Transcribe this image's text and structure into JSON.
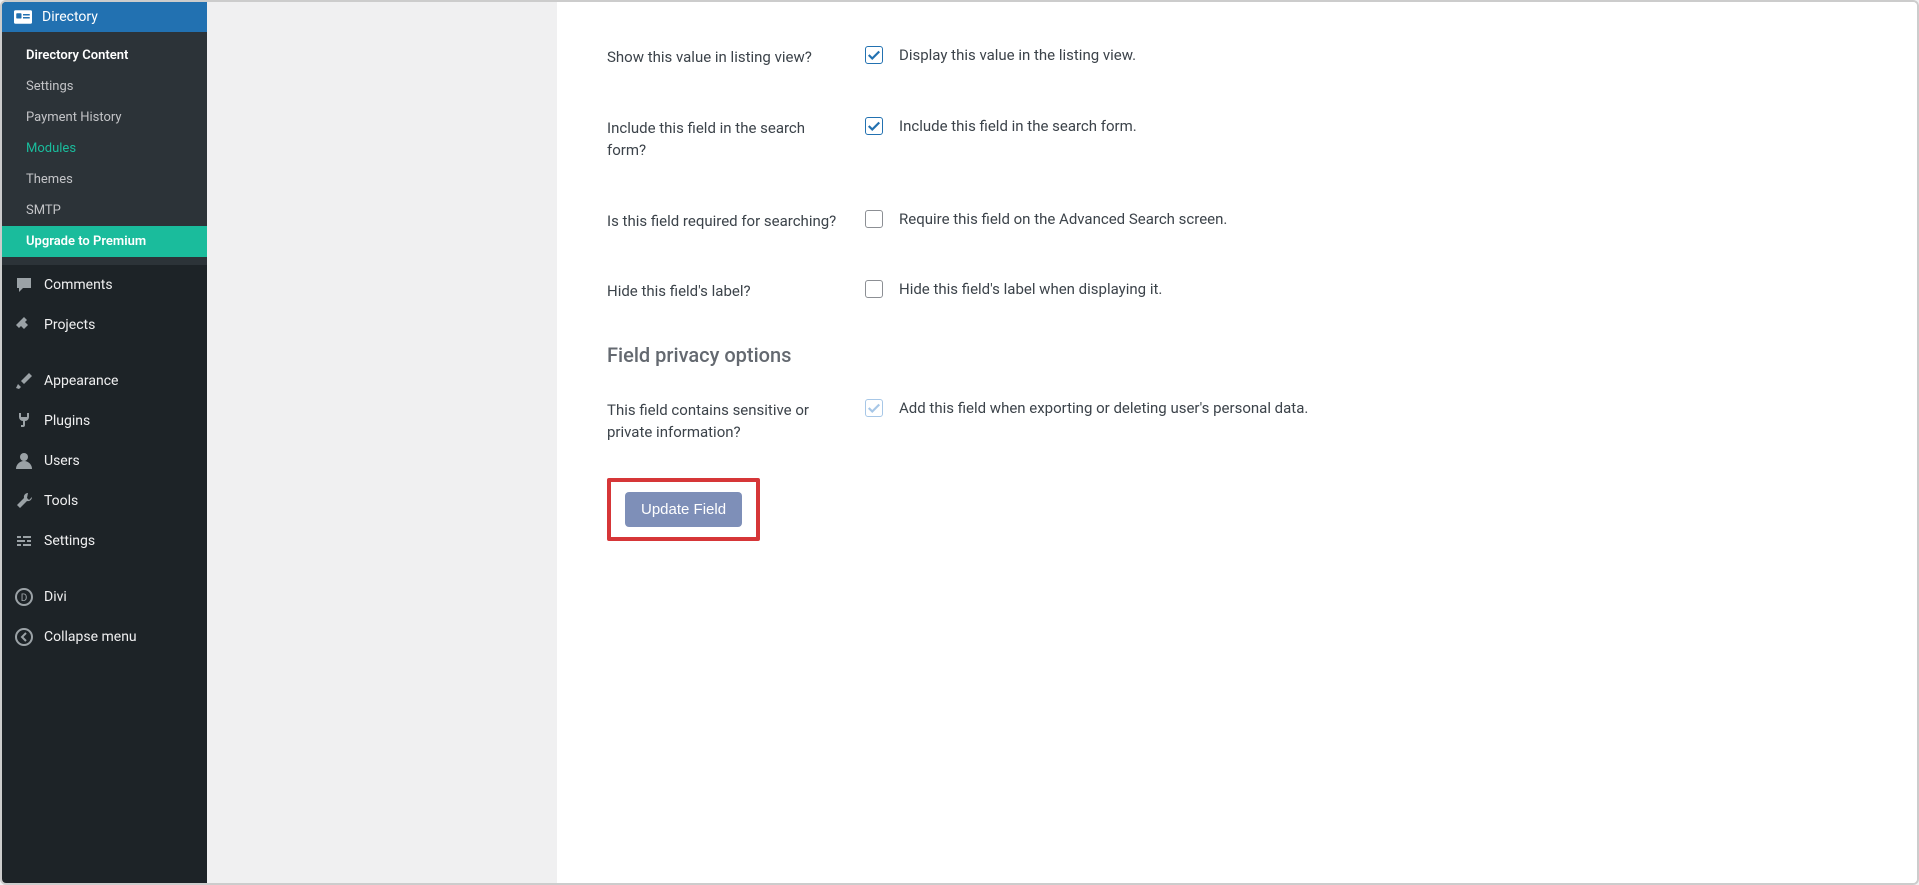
{
  "sidebar": {
    "active_item": "Directory",
    "submenu": [
      {
        "label": "Directory Content",
        "current": true
      },
      {
        "label": "Settings"
      },
      {
        "label": "Payment History"
      },
      {
        "label": "Modules",
        "highlight": true
      },
      {
        "label": "Themes"
      },
      {
        "label": "SMTP"
      }
    ],
    "upgrade_label": "Upgrade to Premium",
    "menu_items": [
      {
        "label": "Comments",
        "icon": "comment"
      },
      {
        "label": "Projects",
        "icon": "pin"
      },
      {
        "label": "Appearance",
        "icon": "brush"
      },
      {
        "label": "Plugins",
        "icon": "plug"
      },
      {
        "label": "Users",
        "icon": "user"
      },
      {
        "label": "Tools",
        "icon": "wrench"
      },
      {
        "label": "Settings",
        "icon": "sliders"
      },
      {
        "label": "Divi",
        "icon": "divi"
      },
      {
        "label": "Collapse menu",
        "icon": "collapse"
      }
    ]
  },
  "form": {
    "rows": [
      {
        "label": "Show this value in listing view?",
        "desc": "Display this value in the listing view.",
        "checked": true
      },
      {
        "label": "Include this field in the search form?",
        "desc": "Include this field in the search form.",
        "checked": true
      },
      {
        "label": "Is this field required for searching?",
        "desc": "Require this field on the Advanced Search screen.",
        "checked": false
      },
      {
        "label": "Hide this field's label?",
        "desc": "Hide this field's label when displaying it.",
        "checked": false
      }
    ],
    "section_heading": "Field privacy options",
    "privacy_row": {
      "label": "This field contains sensitive or private information?",
      "desc": "Add this field when exporting or deleting user's personal data.",
      "checked_disabled": true
    },
    "update_button": "Update Field"
  }
}
